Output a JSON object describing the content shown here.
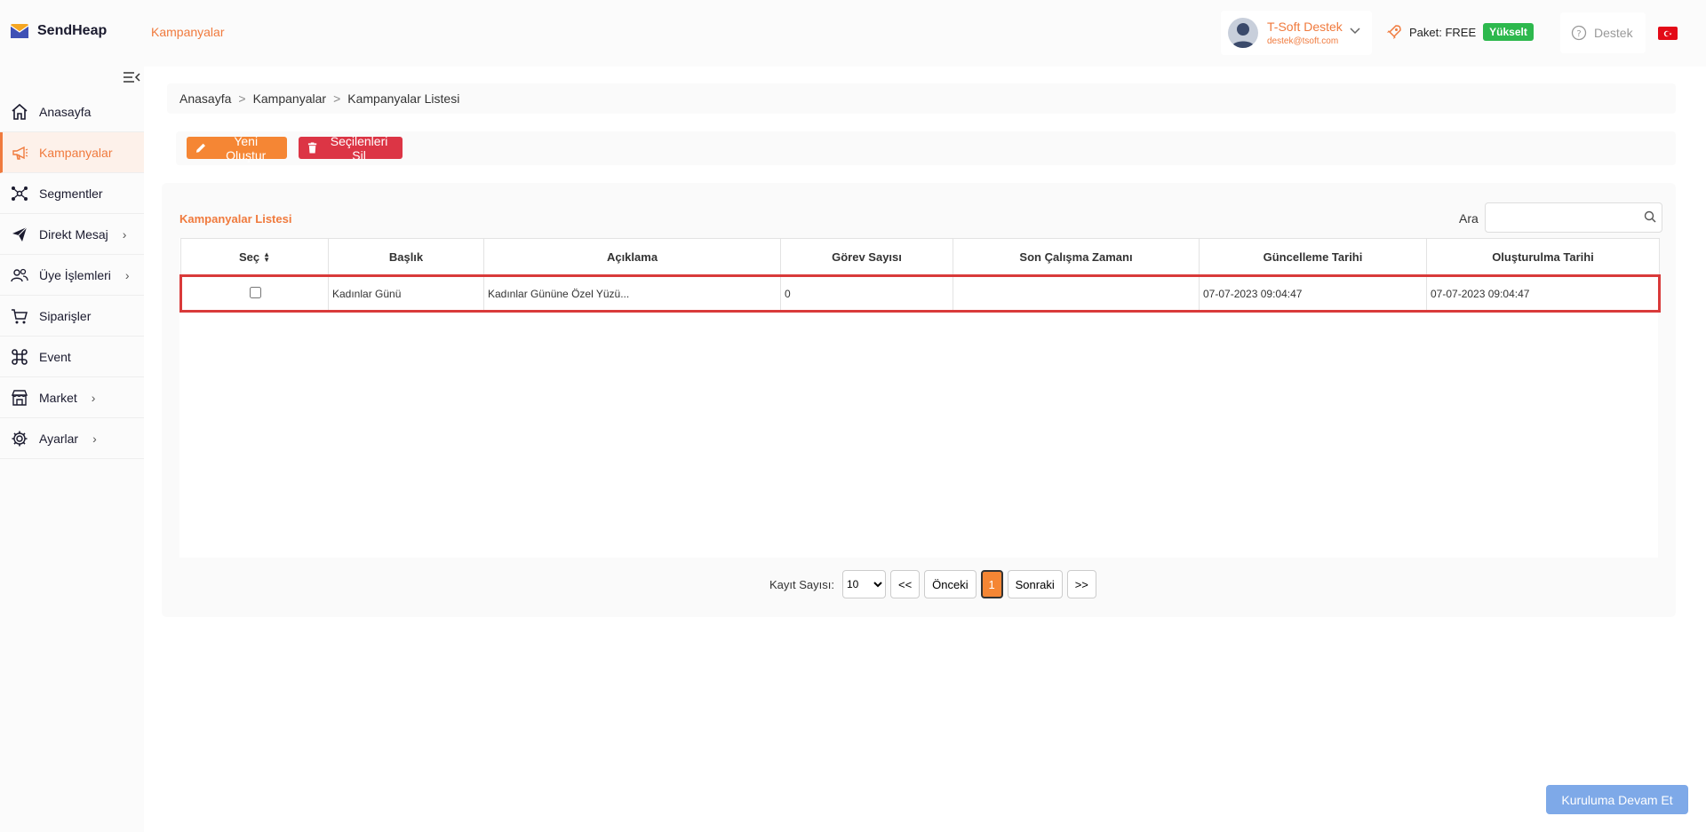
{
  "app": {
    "name": "SendHeap",
    "page_heading": "Kampanyalar"
  },
  "user": {
    "name": "T-Soft Destek",
    "email": "destek@tsoft.com"
  },
  "package": {
    "label": "Paket: FREE",
    "upgrade": "Yükselt"
  },
  "support": {
    "label": "Destek"
  },
  "sidebar": {
    "items": [
      {
        "label": "Anasayfa",
        "icon": "home-icon"
      },
      {
        "label": "Kampanyalar",
        "icon": "megaphone-icon",
        "active": true
      },
      {
        "label": "Segmentler",
        "icon": "network-icon"
      },
      {
        "label": "Direkt Mesaj",
        "icon": "paper-plane-icon",
        "has_children": true
      },
      {
        "label": "Üye İşlemleri",
        "icon": "users-icon",
        "has_children": true
      },
      {
        "label": "Siparişler",
        "icon": "cart-icon"
      },
      {
        "label": "Event",
        "icon": "command-icon"
      },
      {
        "label": "Market",
        "icon": "store-icon",
        "has_children": true
      },
      {
        "label": "Ayarlar",
        "icon": "gear-icon",
        "has_children": true
      }
    ]
  },
  "breadcrumb": [
    "Anasayfa",
    "Kampanyalar",
    "Kampanyalar Listesi"
  ],
  "actions": {
    "new": "Yeni Oluştur",
    "delete": "Seçilenleri Sil"
  },
  "list": {
    "title": "Kampanyalar Listesi",
    "search_label": "Ara",
    "search_value": "",
    "columns": [
      "Seç",
      "Başlık",
      "Açıklama",
      "Görev Sayısı",
      "Son Çalışma Zamanı",
      "Güncelleme Tarihi",
      "Oluşturulma Tarihi"
    ],
    "rows": [
      {
        "selected": false,
        "title": "Kadınlar Günü",
        "description": "Kadınlar Gününe Özel Yüzü...",
        "task_count": "0",
        "last_run": "",
        "updated": "07-07-2023 09:04:47",
        "created": "07-07-2023 09:04:47"
      }
    ]
  },
  "pagination": {
    "records_label": "Kayıt Sayısı:",
    "page_size": "10",
    "first": "<<",
    "prev": "Önceki",
    "current": "1",
    "next": "Sonraki",
    "last": ">>"
  },
  "continue_button": "Kuruluma Devam Et",
  "colors": {
    "accent": "#f07a3d",
    "danger": "#dc3545",
    "success": "#2db84d",
    "primary_light": "#7ea9e8"
  }
}
